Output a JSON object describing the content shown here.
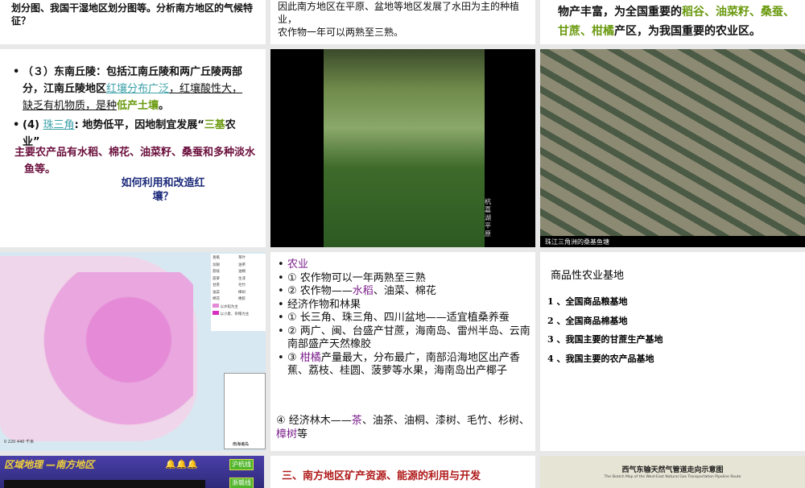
{
  "slides": {
    "s1": {
      "text": "划分图、我国干湿地区划分图等。分析南方地区的气候特征？"
    },
    "s2": {
      "line1": "因此南方地区在平原、盆地等地区发展了水田为主的种植业，",
      "line2": "农作物一年可以两熟至三熟。"
    },
    "s3": {
      "pre": "物产丰富，为全国重要的",
      "hl1": "稻谷、油菜籽、桑蚕、甘蔗、柑橘",
      "post": "产区，为我国重要的农业区。"
    },
    "s4": {
      "b1_a": "（３）东南丘陵：包括江南丘陵和两广丘陵两部分，江南丘陵地区",
      "b1_link": "红壤分布广泛",
      "b1_b": "，红壤酸性大，缺乏有机物质，是种",
      "b1_hl": "低产土壤",
      "b1_end": "。",
      "b2_a": "(4) ",
      "b2_link": "珠三角",
      "b2_b": ": 地势低平，因地制宜发展“",
      "b2_hl": "三基",
      "b2_c": "农业”",
      "products": "主要农产品有水稻、棉花、油菜籽、桑蚕和多种淡水鱼等。",
      "question": "如何利用和改造红壤？"
    },
    "s5": {
      "caption": "杭嘉湖平原"
    },
    "s6": {
      "caption": "珠江三角洲的桑基鱼塘"
    },
    "s7": {
      "legend": [
        "香蕉",
        "龙眼",
        "荔枝",
        "菠萝",
        "甘蔗",
        "油菜",
        "棉花",
        "茶叶",
        "油茶",
        "油桐",
        "生漆",
        "毛竹",
        "樟树",
        "橡胶"
      ],
      "legend_area": [
        "以水稻为主",
        "以小麦、杂粮为主"
      ],
      "scale": "0   220   440 千米",
      "inset": "南海诸岛",
      "colors": {
        "rice": "#e58ad6",
        "wheat": "#d62ec0"
      }
    },
    "s8": {
      "items": [
        {
          "parts": [
            {
              "t": "农业",
              "c": "purple"
            }
          ]
        },
        {
          "parts": [
            {
              "t": "① 农作物可以一年两熟至三熟"
            }
          ]
        },
        {
          "parts": [
            {
              "t": "② 农作物——"
            },
            {
              "t": "水稻",
              "c": "purple"
            },
            {
              "t": "、油菜、棉花"
            }
          ]
        },
        {
          "parts": [
            {
              "t": "经济作物和林果"
            }
          ]
        },
        {
          "parts": [
            {
              "t": "① 长三角、珠三角、四川盆地——适宜植桑养蚕"
            }
          ]
        },
        {
          "parts": [
            {
              "t": "② 两广、闽、台盛产甘蔗，海南岛、雷州半岛、云南南部盛产天然橡胶"
            }
          ]
        },
        {
          "parts": [
            {
              "t": "③ "
            },
            {
              "t": "柑橘",
              "c": "purple"
            },
            {
              "t": "产量最大，分布最广，南部沿海地区出产香蕉、荔枝、桂圆、菠萝等水果，海南岛出产椰子"
            }
          ]
        }
      ],
      "last": {
        "a": "④ 经济林木——",
        "b": "茶",
        "c": "、油茶、油桐、漆树、毛竹、杉树、",
        "d": "樟树",
        "e": "等"
      }
    },
    "s9": {
      "title": "商品性农业基地",
      "items": [
        "1 、全国商品粮基地",
        "2 、全国商品棉基地",
        "3 、我国主要的甘蔗生产基地",
        "4 、我国主要的农产品基地"
      ]
    },
    "s10": {
      "title": "区域地理 —南方地区",
      "btn1": "沪杭线",
      "btn2": "浙赣线"
    },
    "s11": {
      "title": "三、南方地区矿产资源、能源的利用与开发"
    },
    "s12": {
      "title": "西气东输天然气管道走向示意图",
      "subtitle": "The Sketch Map of the West-East Natural Gas Transportation Pipeline Route"
    }
  }
}
